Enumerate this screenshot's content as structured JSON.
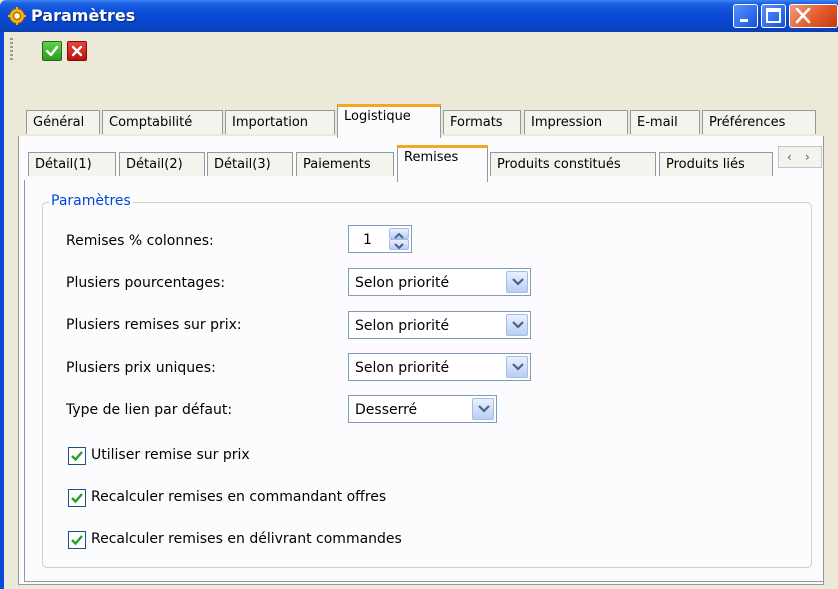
{
  "window": {
    "title": "Paramètres",
    "icon": "gear-icon",
    "controls": [
      "minimize-icon",
      "maximize-icon",
      "close-icon"
    ]
  },
  "toolbar": {
    "buttons": [
      {
        "name": "ok-button",
        "icon": "checkmark-icon",
        "color": "#2e9a1d"
      },
      {
        "name": "cancel-button",
        "icon": "x-icon",
        "color": "#c41a10"
      }
    ]
  },
  "main_tabs": [
    {
      "label": "Général"
    },
    {
      "label": "Comptabilité"
    },
    {
      "label": "Importation"
    },
    {
      "label": "Logistique",
      "active": true
    },
    {
      "label": "Formats"
    },
    {
      "label": "Impression"
    },
    {
      "label": "E-mail"
    },
    {
      "label": "Préférences"
    }
  ],
  "sub_tabs": [
    {
      "label": "Détail(1)"
    },
    {
      "label": "Détail(2)"
    },
    {
      "label": "Détail(3)"
    },
    {
      "label": "Paiements"
    },
    {
      "label": "Remises",
      "active": true
    },
    {
      "label": "Produits constitués"
    },
    {
      "label": "Produits liés"
    }
  ],
  "sub_tab_scroll": {
    "left": "‹",
    "right": "›"
  },
  "group": {
    "title": "Paramètres",
    "fields": [
      {
        "label": "Remises % colonnes:",
        "type": "spinner",
        "value": "1"
      },
      {
        "label": "Plusiers pourcentages:",
        "type": "select",
        "value": "Selon priorité"
      },
      {
        "label": "Plusiers remises sur prix:",
        "type": "select",
        "value": "Selon priorité"
      },
      {
        "label": "Plusiers prix uniques:",
        "type": "select",
        "value": "Selon priorité"
      },
      {
        "label": "Type de lien par défaut:",
        "type": "select",
        "value": "Desserré"
      }
    ],
    "checkboxes": [
      {
        "label": "Utiliser remise sur prix",
        "checked": true
      },
      {
        "label": "Recalculer remises en commandant offres",
        "checked": true
      },
      {
        "label": "Recalculer remises en délivrant commandes",
        "checked": true
      }
    ]
  },
  "colors": {
    "titlebar": "#0a4ad8",
    "active_tab_accent": "#f5a623",
    "group_title": "#0046d5",
    "check_green": "#21a121"
  }
}
